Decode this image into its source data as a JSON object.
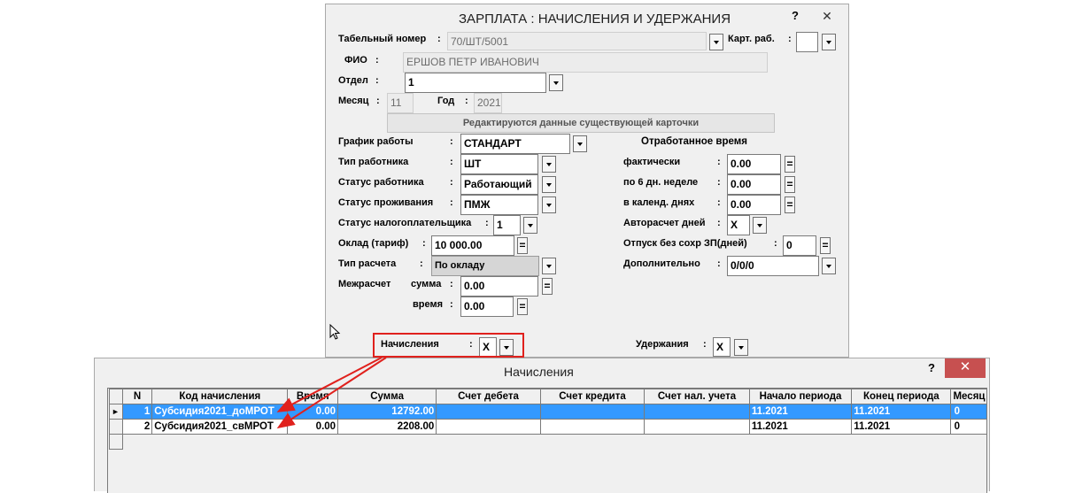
{
  "main_window": {
    "title": "ЗАРПЛАТА : НАЧИСЛЕНИЯ И УДЕРЖАНИЯ",
    "help": "?",
    "close": "✕"
  },
  "form": {
    "tabnum_label": "Табельный номер",
    "tabnum_value": "70/ШТ/5001",
    "kart_label": "Карт. раб.",
    "kart_value": "",
    "fio_label": "ФИО",
    "fio_value": "ЕРШОВ ПЕТР ИВАНОВИЧ",
    "otdel_label": "Отдел",
    "otdel_value": "1",
    "month_label": "Месяц",
    "month_value": "11",
    "year_label": "Год",
    "year_value": "2021",
    "banner": "Редактируются данные существующей карточки",
    "colon": ":",
    "schedule_label": "График работы",
    "schedule_value": "СТАНДАРТ",
    "worker_type_label": "Тип работника",
    "worker_type_value": "ШТ",
    "worker_status_label": "Статус работника",
    "worker_status_value": "Работающий",
    "residence_label": "Статус проживания",
    "residence_value": "ПМЖ",
    "taxpayer_label": "Статус налогоплательщика",
    "taxpayer_value": "1",
    "salary_label": "Оклад (тариф)",
    "salary_value": "10 000.00",
    "calc_type_label": "Тип расчета",
    "calc_type_value": "По окладу",
    "mezh_label": "Межрасчет",
    "mezh_sum_label": "сумма",
    "mezh_sum_value": "0.00",
    "mezh_time_label": "время",
    "mezh_time_value": "0.00",
    "worked_header": "Отработанное время",
    "fact_label": "фактически",
    "fact_value": "0.00",
    "six_day_label": "по 6 дн. неделе",
    "six_day_value": "0.00",
    "calendar_label": "в календ. днях",
    "calendar_value": "0.00",
    "auto_days_label": "Авторасчет дней",
    "auto_days_value": "X",
    "leave_label": "Отпуск без сохр ЗП(дней)",
    "leave_value": "0",
    "additional_label": "Дополнительно",
    "additional_value": "0/0/0",
    "accruals_label": "Начисления",
    "accruals_value": "X",
    "deductions_label": "Удержания",
    "deductions_value": "X",
    "eq": "="
  },
  "accruals_window": {
    "title": "Начисления",
    "help": "?",
    "close": "✕",
    "columns": [
      "N",
      "Код начисления",
      "Время",
      "Сумма",
      "Счет дебета",
      "Счет кредита",
      "Счет нал. учета",
      "Начало периода",
      "Конец периода",
      "Месяц"
    ],
    "rows": [
      {
        "n": "1",
        "code": "Субсидия2021_доМРОТ",
        "time": "0.00",
        "sum": "12792.00",
        "debit": "",
        "credit": "",
        "tax": "",
        "start": "11.2021",
        "end": "11.2021",
        "month": "0"
      },
      {
        "n": "2",
        "code": "Субсидия2021_свМРОТ",
        "time": "0.00",
        "sum": "2208.00",
        "debit": "",
        "credit": "",
        "tax": "",
        "start": "11.2021",
        "end": "11.2021",
        "month": "0"
      }
    ]
  },
  "colors": {
    "highlight_box": "#e0211d",
    "selected_row": "#3399ff",
    "close_button": "#c75050"
  }
}
